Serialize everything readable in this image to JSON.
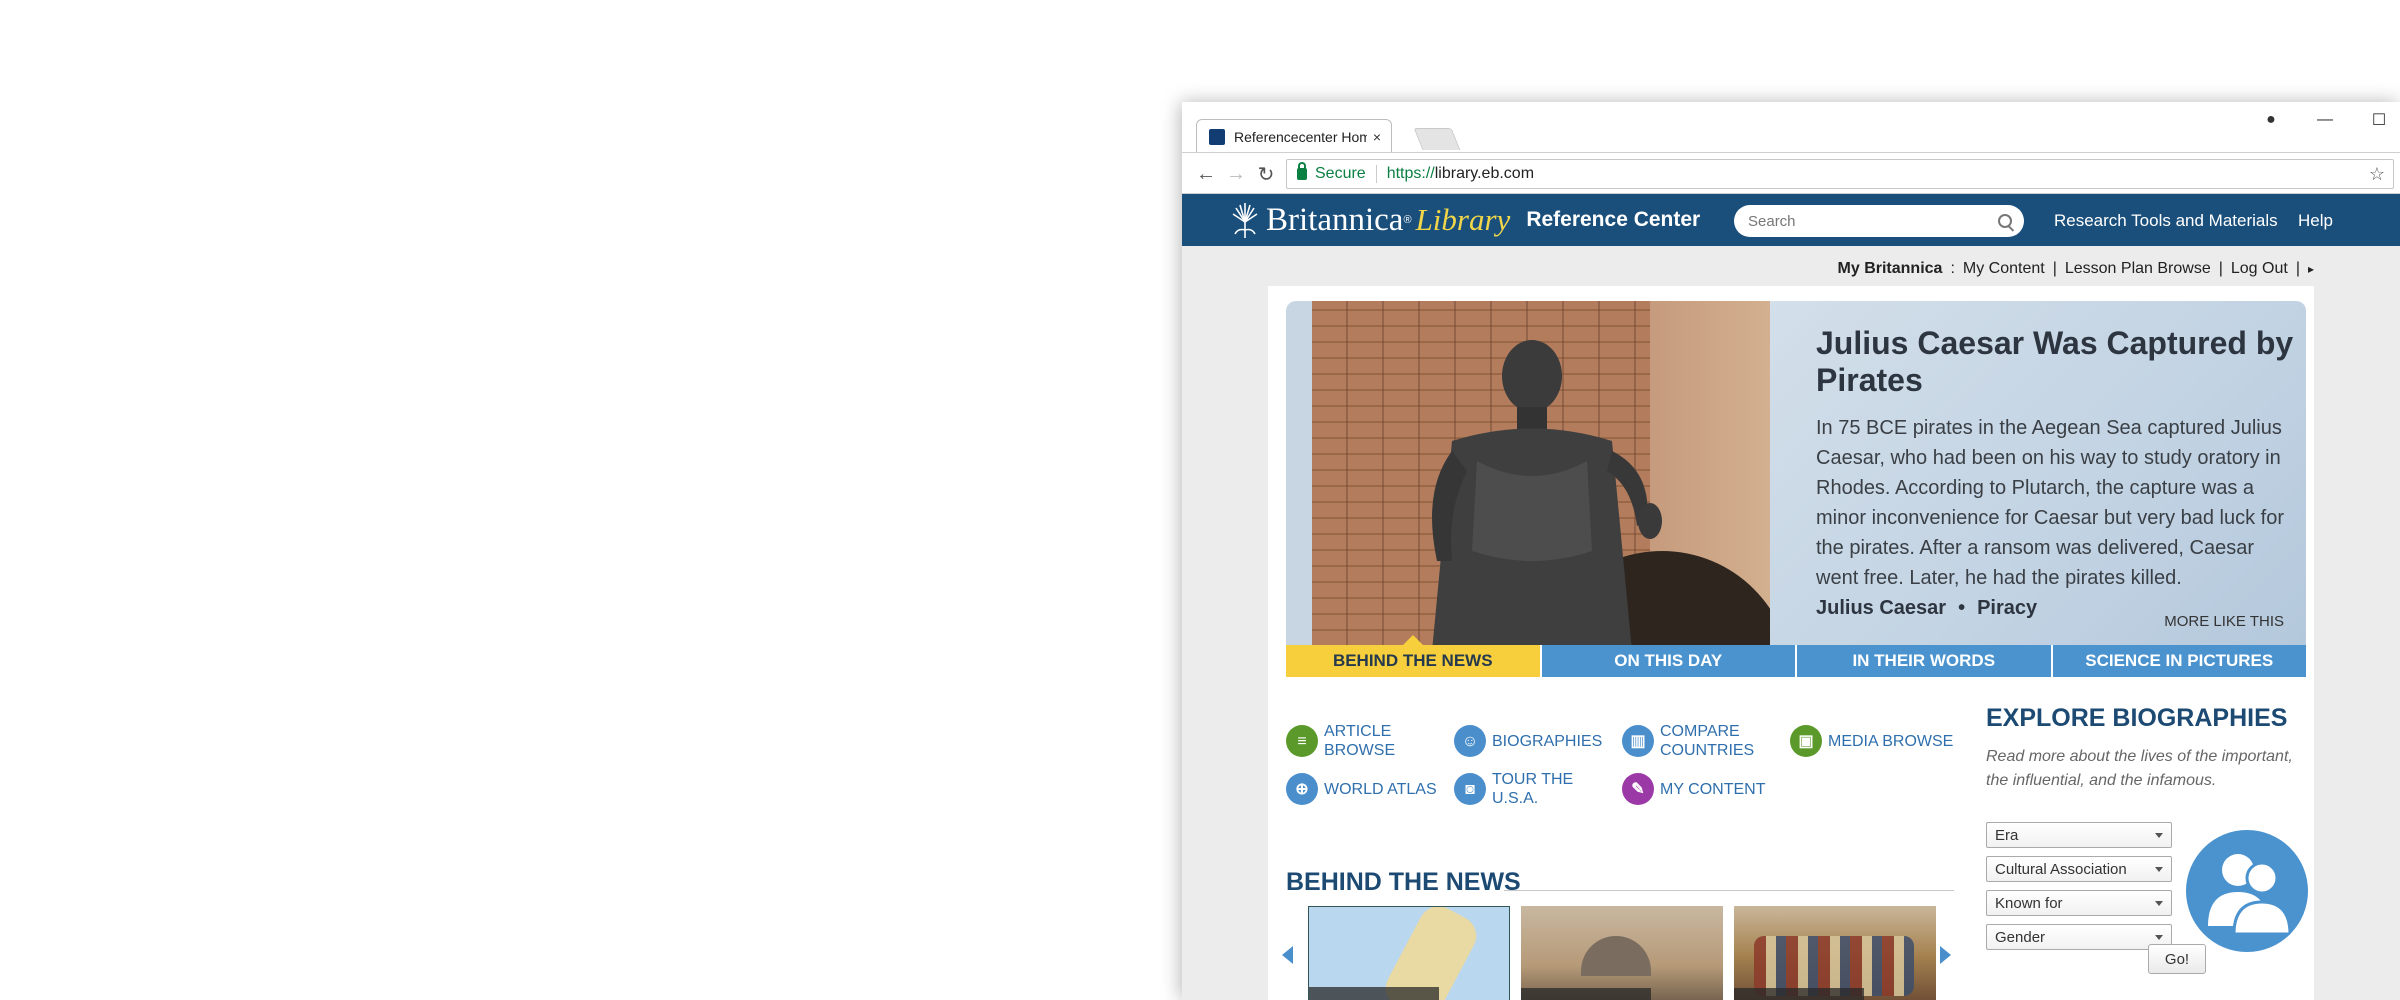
{
  "browser": {
    "tab_title": "Referencecenter Home",
    "tab_close": "×",
    "profile_glyph": "●",
    "minimize_glyph": "—",
    "maximize_glyph": "☐",
    "back_glyph": "←",
    "forward_glyph": "→",
    "reload_glyph": "↻",
    "secure_label": "Secure",
    "url_scheme": "https://",
    "url_host": "library.eb.com",
    "bookmark_glyph": "☆"
  },
  "site": {
    "logo_britannica": "Britannica",
    "logo_reg": "®",
    "logo_library": "Library",
    "logo_reference_center": "Reference Center",
    "search_placeholder": "Search",
    "nav": {
      "research_tools": "Research Tools and Materials",
      "help": "Help"
    },
    "utility": {
      "my_britannica": "My Britannica",
      "sep_colon": ":",
      "my_content": "My Content",
      "sep1": "|",
      "lesson_plan": "Lesson Plan Browse",
      "sep2": "|",
      "log_out": "Log Out",
      "sep3": "|",
      "arrow": "▸"
    }
  },
  "hero": {
    "title": "Julius Caesar Was Captured by Pirates",
    "body": "In 75 BCE pirates in the Aegean Sea captured Julius Caesar, who had been on his way to study oratory in Rhodes. According to Plutarch, the capture was a minor inconvenience for Caesar but very bad luck for the pirates. After a ransom was delivered, Caesar went free. Later, he had the pirates killed.",
    "tag1": "Julius Caesar",
    "tag_sep": "•",
    "tag2": "Piracy",
    "more_like_this": "MORE LIKE THIS",
    "tabs": [
      "BEHIND THE NEWS",
      "ON THIS DAY",
      "IN THEIR WORDS",
      "SCIENCE IN PICTURES"
    ]
  },
  "quick_links": {
    "article_browse": "ARTICLE BROWSE",
    "biographies": "BIOGRAPHIES",
    "compare_countries": "COMPARE COUNTRIES",
    "media_browse": "MEDIA BROWSE",
    "world_atlas": "WORLD ATLAS",
    "tour_usa": "TOUR THE U.S.A.",
    "my_content": "MY CONTENT"
  },
  "behind_the_news": {
    "title": "BEHIND THE NEWS"
  },
  "explore": {
    "title": "EXPLORE BIOGRAPHIES",
    "description": "Read more about the lives of the important, the influential, and the infamous.",
    "selects": [
      "Era",
      "Cultural Association",
      "Known for",
      "Gender"
    ],
    "go_label": "Go!"
  },
  "colors": {
    "header_blue": "#1a4f7c",
    "tab_blue": "#4a93cf",
    "tab_active_yellow": "#f7cf3d",
    "link_blue": "#2f6fad",
    "heading_navy": "#1c4a73"
  }
}
